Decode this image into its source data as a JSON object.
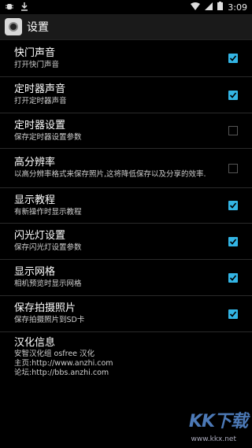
{
  "status": {
    "time": "3:09"
  },
  "actionbar": {
    "title": "设置"
  },
  "settings": [
    {
      "title": "快门声音",
      "subtitle": "打开快门声音",
      "checked": true
    },
    {
      "title": "定时器声音",
      "subtitle": "打开定时器声音",
      "checked": true
    },
    {
      "title": "定时器设置",
      "subtitle": "保存定时器设置参数",
      "checked": false
    },
    {
      "title": "高分辨率",
      "subtitle": "以高分辨率格式来保存照片,这将降低保存以及分享的效率.",
      "checked": false
    },
    {
      "title": "显示教程",
      "subtitle": "有新操作时显示教程",
      "checked": true
    },
    {
      "title": "闪光灯设置",
      "subtitle": "保存闪光灯设置参数",
      "checked": true
    },
    {
      "title": "显示网格",
      "subtitle": "相机预览时显示网格",
      "checked": true
    },
    {
      "title": "保存拍摄照片",
      "subtitle": "保存拍摄照片到SD卡",
      "checked": true
    }
  ],
  "info": {
    "title": "汉化信息",
    "line1": "安智汉化组 osfree 汉化",
    "line2": "主页:http://www.anzhi.com",
    "line3": "论坛:http://bbs.anzhi.com"
  },
  "watermark": {
    "logo": "KK下载",
    "url": "www.kkx.net"
  },
  "colors": {
    "accent": "#33b5e5",
    "background": "#000000"
  }
}
